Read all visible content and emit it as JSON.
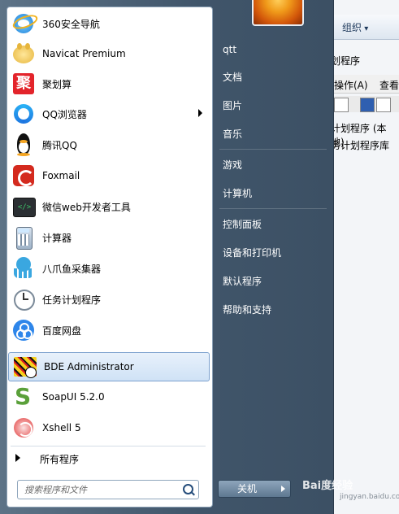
{
  "background_window": {
    "organize_label": "组织",
    "subtitle": "划程序",
    "menu_action": "操作(A)",
    "menu_view": "查看",
    "tree_item_1": "计划程序 (本地)",
    "tree_item_2": "务计划程序库"
  },
  "left_pane": {
    "items": [
      {
        "label": "360安全导航",
        "icon": "ie-icon"
      },
      {
        "label": "Navicat Premium",
        "icon": "navicat-icon"
      },
      {
        "label": "聚划算",
        "icon": "juhuasuan-icon"
      },
      {
        "label": "QQ浏览器",
        "icon": "qq-browser-icon"
      },
      {
        "label": "腾讯QQ",
        "icon": "qq-penguin-icon"
      },
      {
        "label": "Foxmail",
        "icon": "foxmail-icon"
      },
      {
        "label": "微信web开发者工具",
        "icon": "wechat-devtools-icon"
      },
      {
        "label": "计算器",
        "icon": "calculator-icon"
      },
      {
        "label": "八爪鱼采集器",
        "icon": "octopus-icon"
      },
      {
        "label": "任务计划程序",
        "icon": "clock-icon"
      },
      {
        "label": "百度网盘",
        "icon": "baidu-netdisk-icon"
      },
      {
        "label": "BDE Administrator",
        "icon": "bde-icon"
      },
      {
        "label": "SoapUI 5.2.0",
        "icon": "soapui-icon"
      },
      {
        "label": "Xshell 5",
        "icon": "xshell-icon"
      }
    ],
    "selected_index": 11,
    "all_programs_label": "所有程序",
    "search_placeholder": "搜索程序和文件"
  },
  "right_pane": {
    "items": [
      "qtt",
      "文档",
      "图片",
      "音乐",
      "游戏",
      "计算机",
      "控制面板",
      "设备和打印机",
      "默认程序",
      "帮助和支持"
    ],
    "shutdown_label": "关机"
  },
  "watermark": {
    "text": "Bai度经验",
    "sub": "jingyan.baidu.com"
  }
}
